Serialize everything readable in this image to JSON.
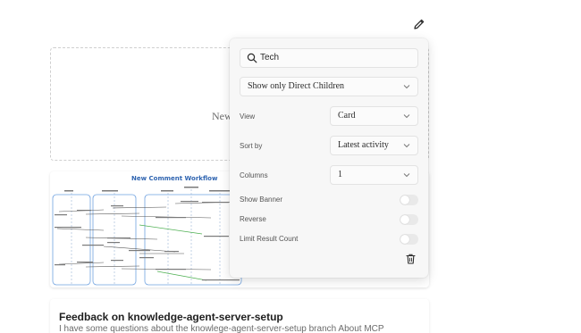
{
  "toolbar": {
    "edit_icon": "pencil-icon"
  },
  "new_card": {
    "label": "New"
  },
  "diagram": {
    "title": "New Comment Workflow"
  },
  "feedback": {
    "title": "Feedback on knowledge-agent-server-setup",
    "description": "I have some questions about the knowlege-agent-server-setup branch About MCP"
  },
  "panel": {
    "search": {
      "value": "Tech",
      "icon": "search-icon"
    },
    "children_filter": {
      "value": "Show only Direct Children"
    },
    "view": {
      "label": "View",
      "value": "Card"
    },
    "sort_by": {
      "label": "Sort by",
      "value": "Latest activity"
    },
    "columns": {
      "label": "Columns",
      "value": "1"
    },
    "toggles": [
      {
        "label": "Show Banner",
        "on": false
      },
      {
        "label": "Reverse",
        "on": false
      },
      {
        "label": "Limit Result Count",
        "on": false
      }
    ],
    "delete_icon": "trash-icon"
  }
}
